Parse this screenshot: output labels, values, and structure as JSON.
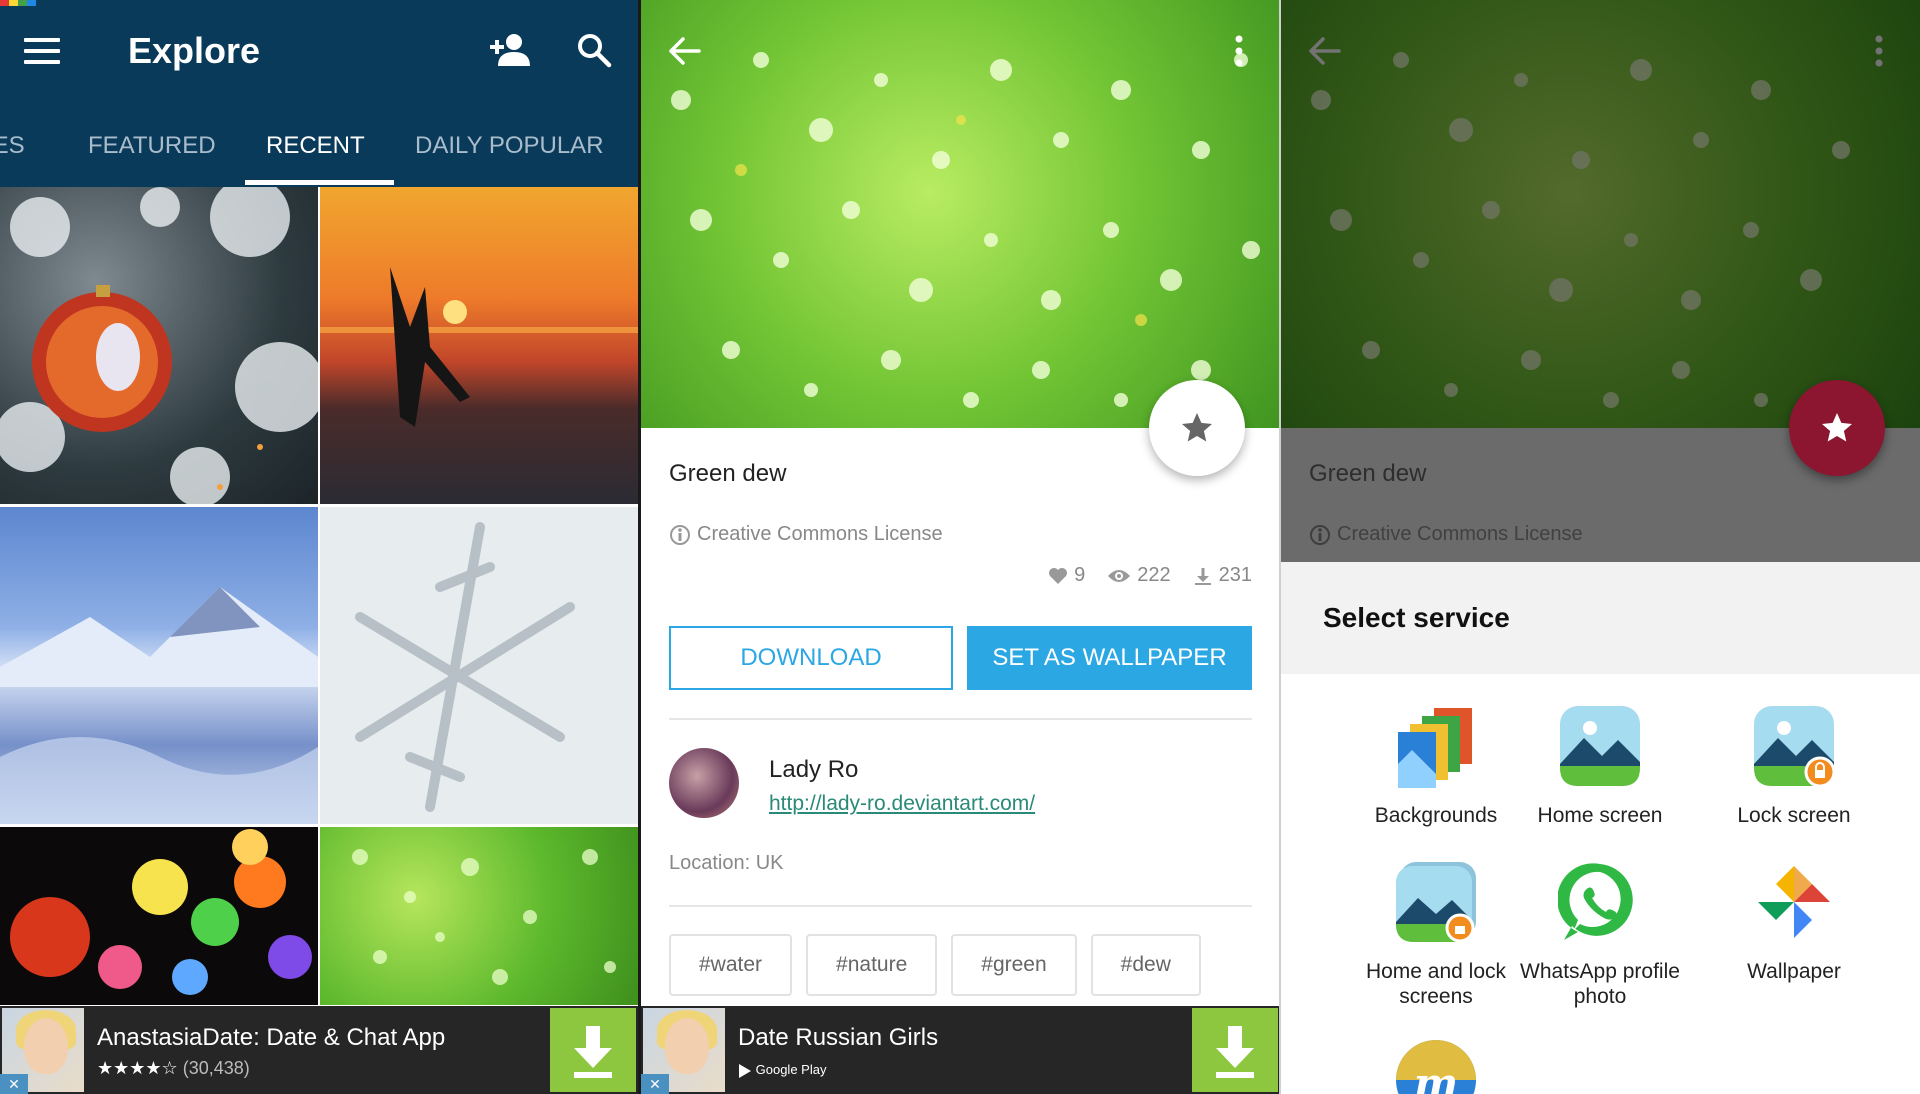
{
  "colors": {
    "appbar": "#0a3a5a",
    "accent": "#2ba7e4",
    "fab_active": "#8c1530",
    "ad_download": "#8dc63f",
    "link": "#2a8a78"
  },
  "screen1": {
    "title": "Explore",
    "icons": [
      "menu-icon",
      "add-person-icon",
      "search-icon"
    ],
    "tabs": [
      {
        "label": "IES",
        "active": false
      },
      {
        "label": "FEATURED",
        "active": false
      },
      {
        "label": "RECENT",
        "active": true
      },
      {
        "label": "DAILY POPULAR",
        "active": false
      }
    ],
    "thumbnails": [
      "christmas-ornament",
      "sunset-beach-dancer",
      "snowy-mountains",
      "snowflake",
      "bokeh-lights",
      "green-dew"
    ],
    "ad": {
      "title": "AnastasiaDate: Date & Chat App",
      "stars": "★★★★☆",
      "rating_count": "(30,438)"
    }
  },
  "screen2": {
    "title": "Green dew",
    "license": "Creative Commons License",
    "likes": "9",
    "views": "222",
    "downloads": "231",
    "download_label": "DOWNLOAD",
    "wallpaper_label": "SET AS WALLPAPER",
    "author": {
      "name": "Lady Ro",
      "url": "http://lady-ro.deviantart.com/"
    },
    "location": "Location: UK",
    "tags": [
      "#water",
      "#nature",
      "#green",
      "#dew"
    ],
    "ad": {
      "title": "Date Russian Girls",
      "store": "Google Play"
    }
  },
  "screen3": {
    "title": "Green dew",
    "license": "Creative Commons License",
    "sheet_title": "Select service",
    "services": [
      {
        "label": "Backgrounds",
        "icon": "backgrounds-icon"
      },
      {
        "label": "Home screen",
        "icon": "home-screen-icon"
      },
      {
        "label": "Lock screen",
        "icon": "lock-screen-icon"
      },
      {
        "label": "Home and lock screens",
        "icon": "home-lock-screens-icon"
      },
      {
        "label": "WhatsApp profile photo",
        "icon": "whatsapp-icon"
      },
      {
        "label": "Wallpaper",
        "icon": "photos-pinwheel-icon"
      }
    ]
  }
}
